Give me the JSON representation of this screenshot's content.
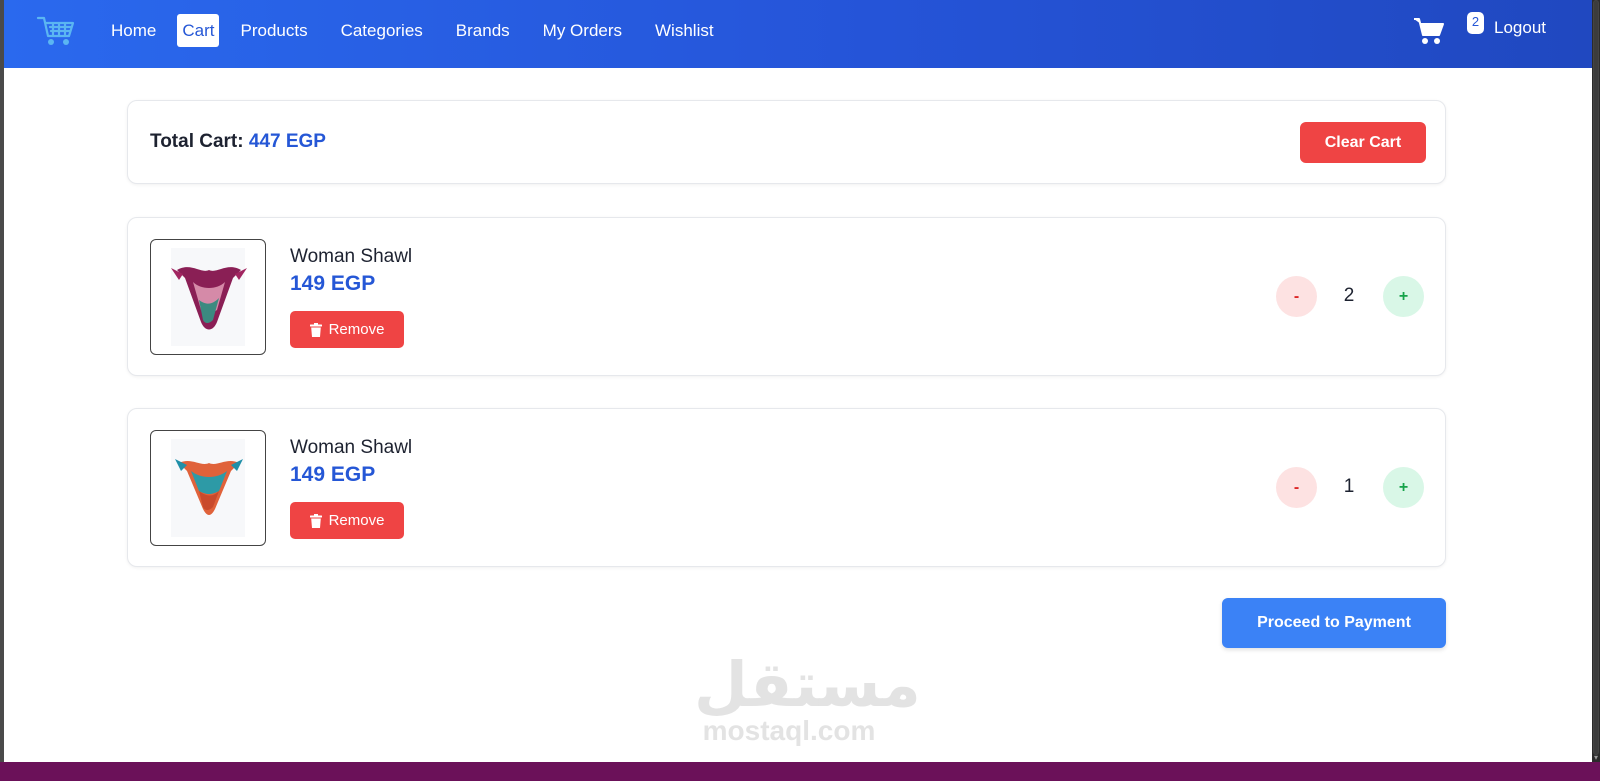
{
  "nav": {
    "links": [
      "Home",
      "Cart",
      "Products",
      "Categories",
      "Brands",
      "My Orders",
      "Wishlist"
    ],
    "active": "Cart",
    "cart_count": "2",
    "logout": "Logout"
  },
  "total": {
    "label": "Total Cart:",
    "amount": "447 EGP",
    "clear_label": "Clear Cart"
  },
  "items": [
    {
      "name": "Woman Shawl",
      "price": "149 EGP",
      "remove_label": "Remove",
      "qty_minus": "-",
      "quantity": "2",
      "qty_plus": "+"
    },
    {
      "name": "Woman Shawl",
      "price": "149 EGP",
      "remove_label": "Remove",
      "qty_minus": "-",
      "quantity": "1",
      "qty_plus": "+"
    }
  ],
  "proceed_label": "Proceed to Payment",
  "watermark": {
    "arabic": "مستقل",
    "latin": "mostaql.com"
  },
  "colors": {
    "nav_gradient_start": "#2a69ee",
    "nav_gradient_end": "#2048c0",
    "accent": "#2557d6",
    "danger": "#ef4444",
    "primary_button": "#3b82f6"
  }
}
